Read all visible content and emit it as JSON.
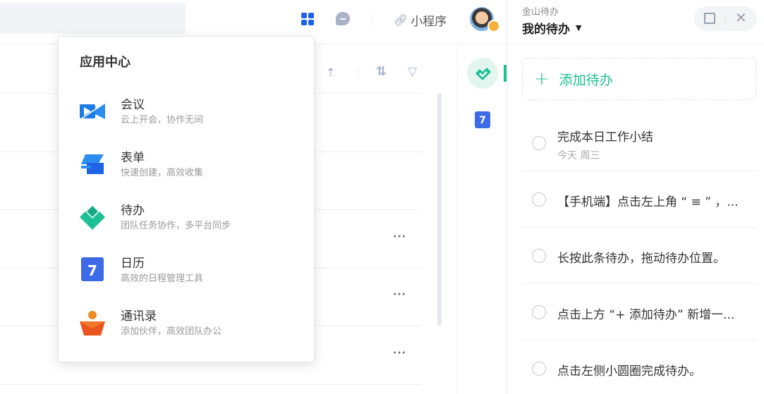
{
  "header": {
    "mini_program_label": "小程序"
  },
  "app_center": {
    "title": "应用中心",
    "items": [
      {
        "name": "会议",
        "desc": "云上开会，协作无间"
      },
      {
        "name": "表单",
        "desc": "快速创建，高效收集"
      },
      {
        "name": "待办",
        "desc": "团队任务协作，多平台同步"
      },
      {
        "name": "日历",
        "desc": "高效的日程管理工具"
      },
      {
        "name": "通讯录",
        "desc": "添加伙伴，高效团队办公"
      }
    ]
  },
  "todo_panel": {
    "app_name": "金山待办",
    "list_title": "我的待办",
    "add_label": "添加待办",
    "calendar_day": "7",
    "items": [
      {
        "title": "完成本日工作小结",
        "sub": "今天 周三"
      },
      {
        "title": "【手机端】点击左上角 “ ≡ ” ，..."
      },
      {
        "title": "长按此条待办，拖动待办位置。"
      },
      {
        "title": "点击上方 “+ 添加待办” 新增一..."
      },
      {
        "title": "点击左侧小圆圈完成待办。"
      }
    ]
  },
  "colors": {
    "accent": "#1dbf94",
    "blue": "#1e62e6"
  }
}
